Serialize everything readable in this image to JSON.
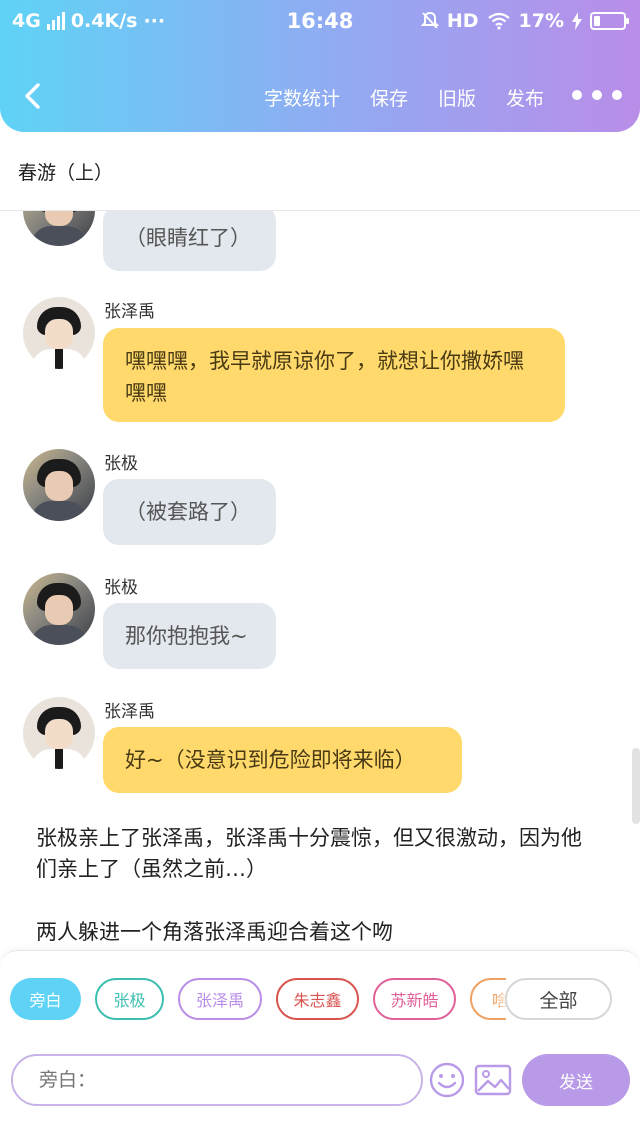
{
  "status_bar": {
    "network": "4G",
    "speed": "0.4K/s",
    "dots": "···",
    "time": "16:48",
    "hd": "HD",
    "battery": "17%"
  },
  "header": {
    "actions": [
      "字数统计",
      "保存",
      "旧版",
      "发布"
    ]
  },
  "document": {
    "title": "春游（上）"
  },
  "messages": [
    {
      "speaker": "",
      "text": "（眼睛红了）",
      "style": "gray",
      "avatar": "zhangji"
    },
    {
      "speaker": "张泽禹",
      "text": "嘿嘿嘿，我早就原谅你了，就想让你撒娇嘿嘿嘿",
      "style": "yellow",
      "avatar": "zhangzeyu"
    },
    {
      "speaker": "张极",
      "text": "（被套路了）",
      "style": "gray",
      "avatar": "zhangji"
    },
    {
      "speaker": "张极",
      "text": "那你抱抱我~",
      "style": "gray",
      "avatar": "zhangji"
    },
    {
      "speaker": "张泽禹",
      "text": "好~（没意识到危险即将来临）",
      "style": "yellow",
      "avatar": "zhangzeyu"
    }
  ],
  "narrations": [
    "张极亲上了张泽禹，张泽禹十分震惊，但又很激动，因为他们亲上了（虽然之前…）",
    "两人躲进一个角落张泽禹迎合着这个吻"
  ],
  "role_chips": [
    {
      "label": "旁白",
      "color": "#5fd3f5",
      "active": true
    },
    {
      "label": "张极",
      "color": "#3cbfb0",
      "active": false
    },
    {
      "label": "张泽禹",
      "color": "#b98de8",
      "active": false
    },
    {
      "label": "朱志鑫",
      "color": "#d9534f",
      "active": false
    },
    {
      "label": "苏新皓",
      "color": "#e0609a",
      "active": false
    },
    {
      "label": "啥",
      "color": "#f0a060",
      "active": false
    }
  ],
  "all_button": "全部",
  "composer": {
    "placeholder": "旁白：",
    "send_label": "发送"
  },
  "icons": {
    "back": "back-arrow-icon",
    "more": "more-dots-icon",
    "emoji": "emoji-icon",
    "image": "image-icon"
  },
  "colors": {
    "header_start": "#5fd3f5",
    "header_end": "#b98de8",
    "bubble_gray": "#e3e8ef",
    "bubble_yellow": "#ffd96b",
    "send": "#b99ae8"
  }
}
